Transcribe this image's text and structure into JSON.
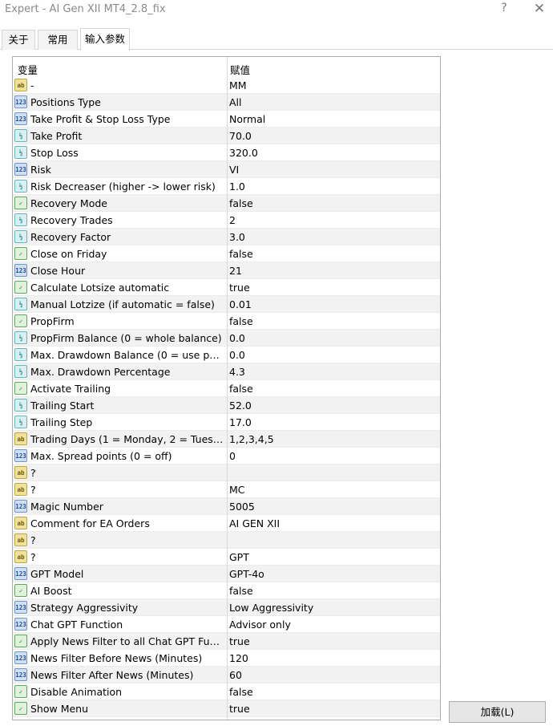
{
  "window": {
    "title": "Expert - AI Gen XII MT4_2.8_fix",
    "help_glyph": "?",
    "close_glyph": "✕"
  },
  "tabs": [
    {
      "label": "关于"
    },
    {
      "label": "常用"
    },
    {
      "label": "输入参数"
    }
  ],
  "table": {
    "header_variable": "变量",
    "header_value": "赋值",
    "rows": [
      {
        "icon": "ab",
        "name": "-",
        "value": " MM"
      },
      {
        "icon": "123",
        "name": "Positions Type",
        "value": "All"
      },
      {
        "icon": "123",
        "name": "Take Profit & Stop Loss Type",
        "value": "Normal"
      },
      {
        "icon": "v2",
        "name": "Take Profit",
        "value": "70.0"
      },
      {
        "icon": "v2",
        "name": "Stop Loss",
        "value": "320.0"
      },
      {
        "icon": "123",
        "name": "Risk",
        "value": "VI"
      },
      {
        "icon": "v2",
        "name": "Risk Decreaser (higher -> lower risk)",
        "value": "1.0"
      },
      {
        "icon": "bool",
        "name": "Recovery Mode",
        "value": "false"
      },
      {
        "icon": "v2",
        "name": "Recovery Trades",
        "value": "2"
      },
      {
        "icon": "v2",
        "name": "Recovery Factor",
        "value": "3.0"
      },
      {
        "icon": "bool",
        "name": "Close on Friday",
        "value": "false"
      },
      {
        "icon": "123",
        "name": "Close Hour",
        "value": "21"
      },
      {
        "icon": "bool",
        "name": "Calculate Lotsize automatic",
        "value": "true"
      },
      {
        "icon": "v2",
        "name": "Manual Lotzize (if automatic = false)",
        "value": "0.01"
      },
      {
        "icon": "bool",
        "name": "PropFirm",
        "value": "false"
      },
      {
        "icon": "v2",
        "name": "PropFirm Balance (0 = whole balance)",
        "value": "0.0"
      },
      {
        "icon": "v2",
        "name": "Max. Drawdown Balance (0 = use perce...",
        "value": "0.0"
      },
      {
        "icon": "v2",
        "name": "Max. Drawdown Percentage",
        "value": "4.3"
      },
      {
        "icon": "bool",
        "name": "Activate Trailing",
        "value": "false"
      },
      {
        "icon": "v2",
        "name": "Trailing Start",
        "value": "52.0"
      },
      {
        "icon": "v2",
        "name": "Trailing Step",
        "value": "17.0"
      },
      {
        "icon": "ab",
        "name": "Trading Days (1 = Monday, 2 = Tuesda...",
        "value": "1,2,3,4,5"
      },
      {
        "icon": "123",
        "name": "Max. Spread points (0 = off)",
        "value": "0"
      },
      {
        "icon": "ab",
        "name": "?",
        "value": ""
      },
      {
        "icon": "ab",
        "name": "?",
        "value": " MC"
      },
      {
        "icon": "123",
        "name": "Magic Number",
        "value": "5005"
      },
      {
        "icon": "ab",
        "name": "Comment for EA Orders",
        "value": "AI GEN XII"
      },
      {
        "icon": "ab",
        "name": "?",
        "value": ""
      },
      {
        "icon": "ab",
        "name": "?",
        "value": " GPT"
      },
      {
        "icon": "123",
        "name": "GPT Model",
        "value": "GPT-4o"
      },
      {
        "icon": "bool",
        "name": "AI Boost",
        "value": "false"
      },
      {
        "icon": "123",
        "name": "Strategy Aggressivity",
        "value": "Low Aggressivity"
      },
      {
        "icon": "123",
        "name": "Chat GPT Function",
        "value": "Advisor only"
      },
      {
        "icon": "bool",
        "name": "Apply News Filter to all Chat GPT Funct...",
        "value": "true"
      },
      {
        "icon": "123",
        "name": "News Filter Before News (Minutes)",
        "value": "120"
      },
      {
        "icon": "123",
        "name": "News Filter After News (Minutes)",
        "value": "60"
      },
      {
        "icon": "bool",
        "name": "Disable Animation",
        "value": "false"
      },
      {
        "icon": "bool",
        "name": "Show Menu",
        "value": "true"
      }
    ]
  },
  "buttons": {
    "load_label": "加载(L)"
  },
  "icon_glyphs": {
    "ab": "ab",
    "123": "123",
    "v2": "½",
    "bool": "✓"
  }
}
